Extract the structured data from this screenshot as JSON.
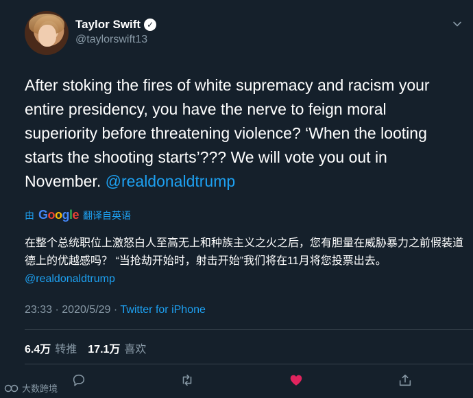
{
  "author": {
    "display_name": "Taylor Swift",
    "verified_glyph": "✓",
    "handle": "@taylorswift13"
  },
  "tweet": {
    "text_before_mention": "After stoking the fires of white supremacy and racism your entire presidency, you have the nerve to feign moral superiority before threatening violence? ‘When the looting starts the shooting starts’??? We will vote you out in November. ",
    "mention": "@realdonaldtrump"
  },
  "translation": {
    "prefix": "由",
    "google_letters": [
      "G",
      "o",
      "o",
      "g",
      "l",
      "e"
    ],
    "suffix": "翻译自英语",
    "text_before_mention": "在整个总统职位上激怒白人至高无上和种族主义之火之后，您有胆量在威胁暴力之前假装道德上的优越感吗？ “当抢劫开始时，射击开始”我们将在11月将您投票出去。 ",
    "mention": "@realdonaldtrump"
  },
  "meta": {
    "time": "23:33",
    "separator": " · ",
    "date": "2020/5/29",
    "source": "Twitter for iPhone"
  },
  "stats": {
    "retweets_count": "6.4万",
    "retweets_label": "转推",
    "likes_count": "17.1万",
    "likes_label": "喜欢"
  },
  "actions": {
    "icons": [
      "reply-icon",
      "retweet-icon",
      "like-icon",
      "share-icon"
    ],
    "like_active_color": "#e0245e"
  },
  "watermark": {
    "text": "大数跨境"
  },
  "colors": {
    "background": "#15202b",
    "accent": "#1da1f2",
    "secondary_text": "#8899a6"
  }
}
